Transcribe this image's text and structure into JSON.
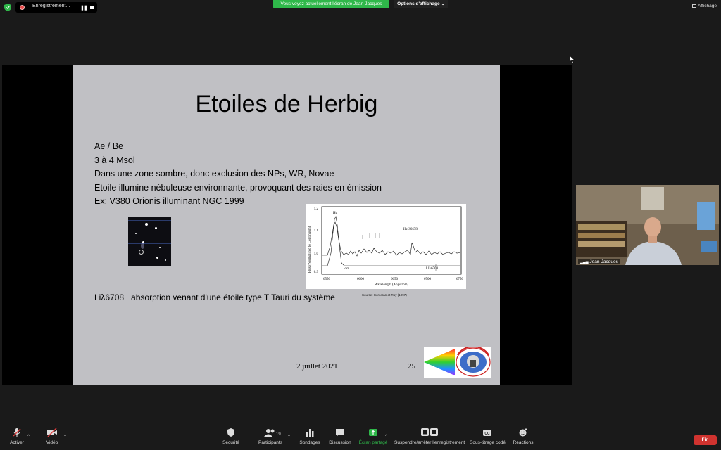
{
  "top": {
    "recording_label": "Enregistrement...",
    "share_banner": "Vous voyez actuellement l'écran de Jean-Jacques",
    "view_options": "Options d'affichage",
    "view_options_caret": "⌄",
    "affichage": "Affichage"
  },
  "slide": {
    "title": "Etoiles de Herbig",
    "bullets": [
      "Ae / Be",
      "3 à 4 Msol",
      "Dans une zone sombre, donc exclusion des NPs, WR, Novae",
      "Etoile illumine nébuleuse environnante, provoquant des raies en émission",
      "Ex: V380 Orionis illuminant NGC 1999"
    ],
    "li_line_a": "Liλ6708",
    "li_line_b": "absorption venant d'une étoile type T Tauri du système",
    "source": "Source: Corcoran et Ray (1997)",
    "date": "2 juillet 2021",
    "number": "25",
    "spectrum": {
      "ylabel": "Flux (Normalized to Continuum)",
      "xlabel": "Wavelength (Angstrom)",
      "label_halpha": "Hα",
      "label_hei": "HeIλ6678",
      "label_li": "LIλ6708",
      "label_x50": "x50",
      "yticks": [
        "1.2",
        "1.1",
        "1.0",
        "0.9"
      ],
      "xticks": [
        "6550",
        "6600",
        "6650",
        "6700",
        "6750"
      ]
    }
  },
  "video": {
    "name": "Jean-Jacques"
  },
  "toolbar": {
    "activer": "Activer",
    "video": "Vidéo",
    "securite": "Sécurité",
    "participants": "Participants",
    "participants_count": "19",
    "sondages": "Sondages",
    "discussion": "Discussion",
    "ecran_partage": "Écran partagé",
    "enregistrement": "Suspendre/arrêter l'enregistrement",
    "sous_titrage": "Sous-titrage codé",
    "reactions": "Réactions",
    "fin": "Fin"
  },
  "colors": {
    "share_green": "#2fb84a",
    "end_red": "#d0332f",
    "record_red": "#e84b4b"
  }
}
